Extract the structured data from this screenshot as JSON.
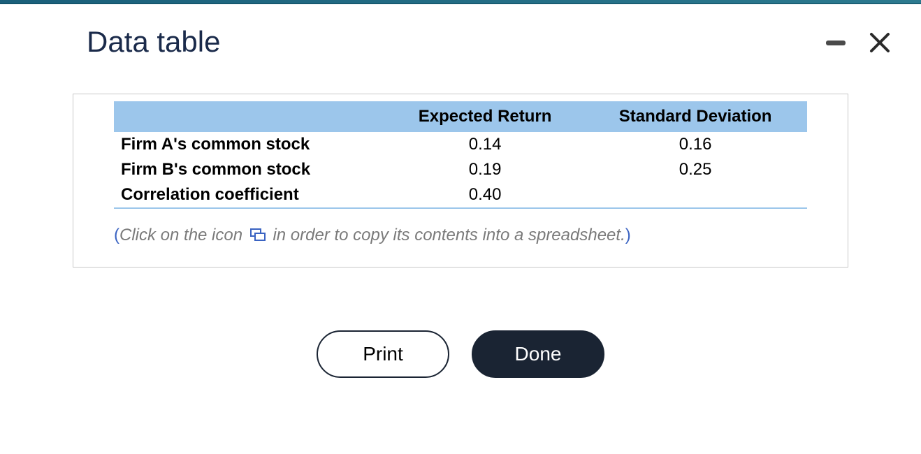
{
  "dialog": {
    "title": "Data table"
  },
  "table": {
    "headers": {
      "col0": "",
      "col1": "Expected Return",
      "col2": "Standard Deviation"
    },
    "rows": [
      {
        "label": "Firm A's common stock",
        "expected_return": "0.14",
        "std_dev": "0.16"
      },
      {
        "label": "Firm B's common stock",
        "expected_return": "0.19",
        "std_dev": "0.25"
      },
      {
        "label": "Correlation coefficient",
        "expected_return": "0.40",
        "std_dev": ""
      }
    ]
  },
  "hint": {
    "open_paren": "(",
    "text_before": "Click on the icon",
    "text_after": " in order to copy its contents into a spreadsheet.",
    "close_paren": ")"
  },
  "buttons": {
    "print": "Print",
    "done": "Done"
  },
  "chart_data": {
    "type": "table",
    "title": "Data table",
    "columns": [
      "",
      "Expected Return",
      "Standard Deviation"
    ],
    "rows": [
      [
        "Firm A's common stock",
        0.14,
        0.16
      ],
      [
        "Firm B's common stock",
        0.19,
        0.25
      ],
      [
        "Correlation coefficient",
        0.4,
        null
      ]
    ]
  }
}
